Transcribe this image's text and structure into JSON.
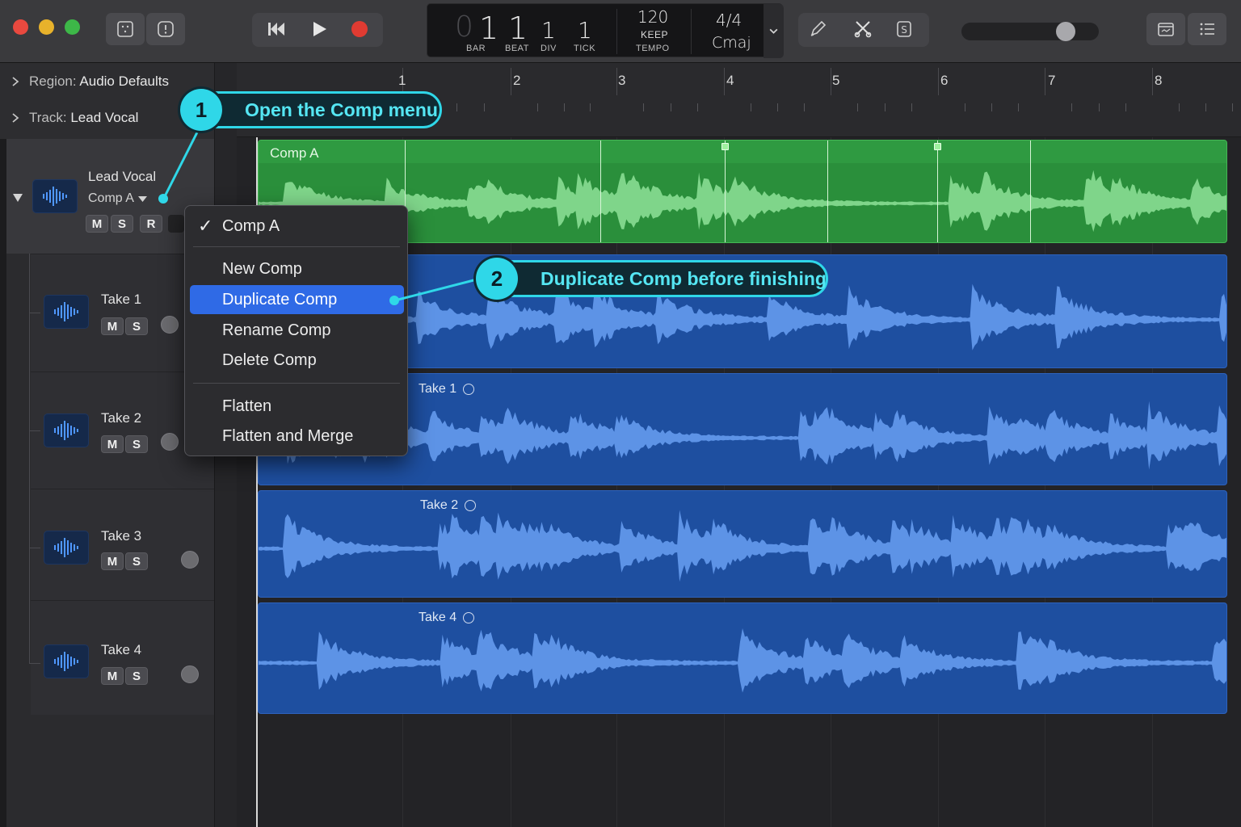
{
  "colors": {
    "accent_cyan": "#2fd7e8",
    "comp_region": "#2a8f3b",
    "take_region": "#1e4fa0",
    "menu_selected": "#2f6ae6",
    "record_red": "#e03b32"
  },
  "toolbar": {
    "traffic_lights": [
      "close",
      "minimize",
      "zoom"
    ],
    "left_buttons": [
      {
        "icon": "library-icon"
      },
      {
        "icon": "inspector-icon"
      }
    ],
    "transport": [
      {
        "icon": "rewind-icon"
      },
      {
        "icon": "play-icon"
      },
      {
        "icon": "record-icon"
      }
    ],
    "lcd": {
      "bar_lead": "0",
      "bar": "1",
      "beat": "1",
      "div": "1",
      "tick": "1",
      "bar_label": "BAR",
      "beat_label": "BEAT",
      "div_label": "DIV",
      "tick_label": "TICK",
      "tempo": "120",
      "tempo_mode": "KEEP",
      "tempo_label": "TEMPO",
      "signature": "4/4",
      "key": "Cmaj"
    },
    "right_tools": [
      {
        "icon": "pencil-icon"
      },
      {
        "icon": "scissors-icon"
      },
      {
        "icon": "solo-icon"
      }
    ],
    "master_volume": 0.8,
    "far_right": [
      {
        "icon": "editor-icon"
      },
      {
        "icon": "list-icon"
      }
    ]
  },
  "inspector": {
    "region_label": "Region:",
    "region_value": "Audio Defaults",
    "track_label": "Track:",
    "track_value": "Lead Vocal"
  },
  "tracks": {
    "main": {
      "name": "Lead Vocal",
      "comp": "Comp A",
      "buttons": [
        "M",
        "S",
        "R"
      ]
    },
    "takes": [
      {
        "name": "Take 1",
        "buttons": [
          "M",
          "S"
        ]
      },
      {
        "name": "Take 2",
        "buttons": [
          "M",
          "S"
        ]
      },
      {
        "name": "Take 3",
        "buttons": [
          "M",
          "S"
        ]
      },
      {
        "name": "Take 4",
        "buttons": [
          "M",
          "S"
        ]
      }
    ]
  },
  "ruler": {
    "bars": [
      "1",
      "2",
      "3",
      "4",
      "5",
      "6",
      "7",
      "8"
    ]
  },
  "regions": {
    "comp": {
      "label": "Comp A"
    },
    "takes": [
      {
        "label": "Take 1"
      },
      {
        "label": "Take 2"
      },
      {
        "label": "Take 4"
      }
    ]
  },
  "menu": {
    "items": [
      {
        "label": "Comp A",
        "checked": true
      },
      {
        "label": "New Comp"
      },
      {
        "label": "Duplicate Comp",
        "selected": true
      },
      {
        "label": "Rename Comp"
      },
      {
        "label": "Delete Comp"
      },
      {
        "label": "Flatten"
      },
      {
        "label": "Flatten and Merge"
      }
    ],
    "check_mark": "✓"
  },
  "callouts": [
    {
      "number": "1",
      "text": "Open the Comp menu"
    },
    {
      "number": "2",
      "text": "Duplicate Comp before finishing"
    }
  ]
}
